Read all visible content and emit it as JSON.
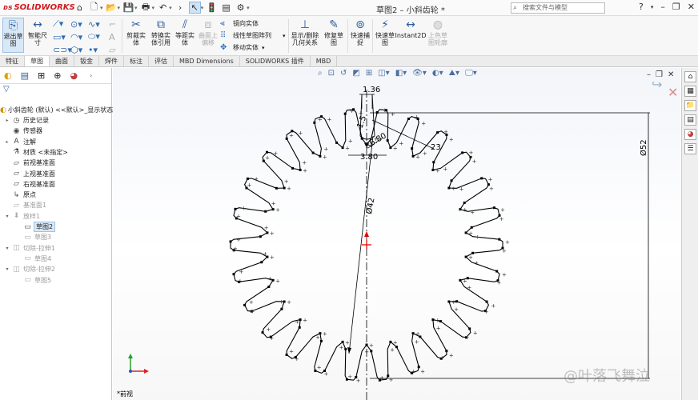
{
  "app": {
    "brand": "SOLIDWORKS",
    "document_title": "草图2 – 小斜齿轮 *"
  },
  "search": {
    "placeholder": "搜索文件与模型"
  },
  "ribbon": {
    "exit_sketch": "退出草图",
    "smart_dimension": "智能尺寸",
    "trim": "剪裁实体",
    "convert": "转换实体引用",
    "offset": "等距实体",
    "surface_offset": "曲面上偏移",
    "mirror": "镜向实体",
    "linear_pattern": "线性草图阵列",
    "move": "移动实体",
    "display_relations": "显示/删除几何关系",
    "repair": "修复草图",
    "snap": "快速捕捉",
    "rapid_sketch": "快速草图",
    "instant2d": "Instant2D",
    "shaded_contours": "上色草图轮廓"
  },
  "tabs": [
    "特征",
    "草图",
    "曲面",
    "钣金",
    "焊件",
    "标注",
    "评估",
    "MBD Dimensions",
    "SOLIDWORKS 插件",
    "MBD"
  ],
  "active_tab": "草图",
  "tree": {
    "root": "小斜齿轮 (默认) <<默认>_显示状态 1",
    "items": [
      "历史记录",
      "传感器",
      "注解",
      "材质 <未指定>",
      "前视基准面",
      "上视基准面",
      "右视基准面",
      "原点",
      "基准面1",
      "放样1",
      "草图2",
      "草图3",
      "切除-拉伸1",
      "草图4",
      "切除-拉伸2",
      "草图5"
    ]
  },
  "dimensions": {
    "d1": "1.36",
    "d2": "1.5",
    "d3": "R6.80",
    "d4": "3.80",
    "d5": "23",
    "d6": "Ø52",
    "d7": "Ø42"
  },
  "view_label": "*前视",
  "watermark": "@叶落飞舞泣",
  "colors": {
    "accent": "#2b5e9e",
    "sketch_line": "#000000",
    "selection": "#d8e8f8",
    "brand": "#d21a22"
  },
  "gear": {
    "teeth": 26
  }
}
